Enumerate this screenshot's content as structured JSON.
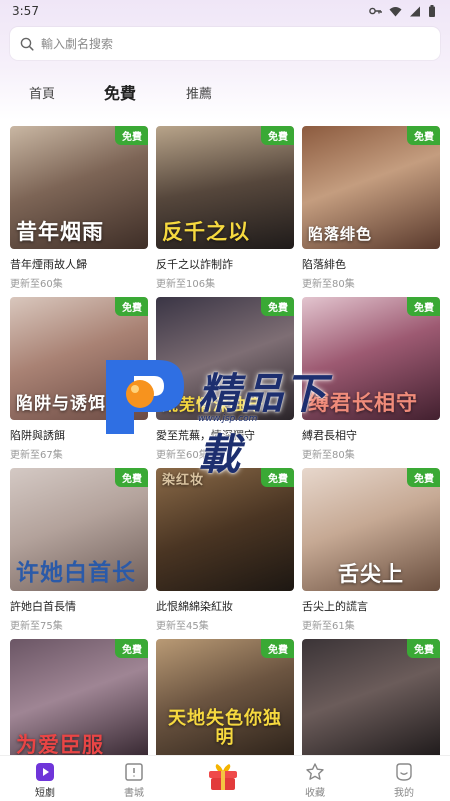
{
  "status_bar": {
    "time": "3:57"
  },
  "search": {
    "placeholder": "輸入劇名搜索"
  },
  "tabs": [
    {
      "label": "首頁",
      "active": false
    },
    {
      "label": "免費",
      "active": true
    },
    {
      "label": "推薦",
      "active": false
    }
  ],
  "badge_text": "免費",
  "dramas": [
    {
      "title": "昔年煙雨故人歸",
      "subtitle": "更新至60集",
      "poster_text": "昔年烟雨"
    },
    {
      "title": "反千之以詐制詐",
      "subtitle": "更新至106集",
      "poster_text": "反千之以"
    },
    {
      "title": "陷落緋色",
      "subtitle": "更新至80集",
      "poster_text": "陷落绯色"
    },
    {
      "title": "陷阱與誘餌",
      "subtitle": "更新至67集",
      "poster_text": "陷阱与诱饵"
    },
    {
      "title": "愛至荒蕪，情深獨守",
      "subtitle": "更新至60集",
      "poster_text": "荒芜情深独守"
    },
    {
      "title": "縛君長相守",
      "subtitle": "更新至80集",
      "poster_text": "缚君长相守"
    },
    {
      "title": "許她白首長情",
      "subtitle": "更新至75集",
      "poster_text": "许她白首长"
    },
    {
      "title": "此恨綿綿染紅妝",
      "subtitle": "更新至45集",
      "poster_text": "染红妆"
    },
    {
      "title": "舌尖上的謊言",
      "subtitle": "更新至61集",
      "poster_text": "舌尖上"
    },
    {
      "title": "",
      "subtitle": "",
      "poster_text": "为爱臣服"
    },
    {
      "title": "",
      "subtitle": "",
      "poster_text": "天地失色你独明"
    },
    {
      "title": "",
      "subtitle": "",
      "poster_text": ""
    }
  ],
  "watermark": {
    "text": "精品下載",
    "url": "www.jsp.com"
  },
  "bottom_nav": [
    {
      "label": "短劇",
      "icon": "play-icon",
      "active": true
    },
    {
      "label": "書城",
      "icon": "book-icon",
      "active": false
    },
    {
      "label": "",
      "icon": "gift-icon",
      "active": false
    },
    {
      "label": "收藏",
      "icon": "star-icon",
      "active": false
    },
    {
      "label": "我的",
      "icon": "profile-icon",
      "active": false
    }
  ],
  "colors": {
    "accent": "#7a3fd6",
    "badge": "#3aa935"
  }
}
